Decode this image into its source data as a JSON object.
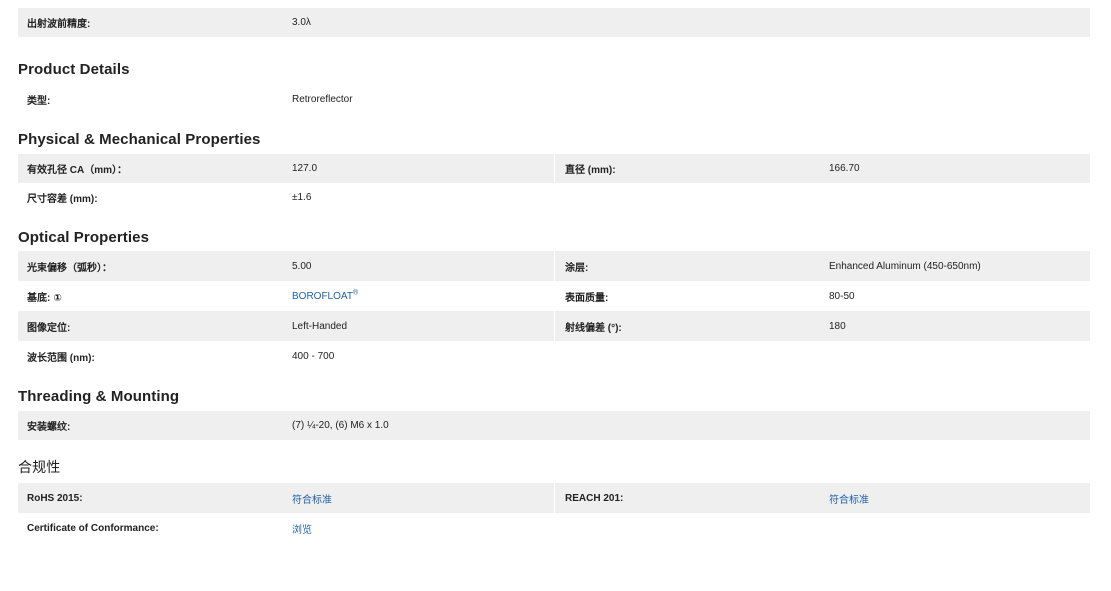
{
  "top_row": {
    "label": "出射波前精度:",
    "value": "3.0λ"
  },
  "sections": {
    "product_details": {
      "title": "Product Details",
      "type_label": "类型:",
      "type_value": "Retroreflector"
    },
    "physical": {
      "title": "Physical & Mechanical Properties",
      "ca_label": "有效孔径 CA（mm）：",
      "ca_value": "127.0",
      "diameter_label": "直径 (mm):",
      "diameter_value": "166.70",
      "tolerance_label": "尺寸容差 (mm):",
      "tolerance_value": "±1.6"
    },
    "optical": {
      "title": "Optical Properties",
      "deviation_label": "光束偏移（弧秒）：",
      "deviation_value": "5.00",
      "coating_label": "涂层:",
      "coating_value": "Enhanced Aluminum (450-650nm)",
      "substrate_label": "基底:",
      "substrate_info_icon": "①",
      "substrate_value": "BOROFLOAT",
      "substrate_sup": "®",
      "surface_label": "表面质量:",
      "surface_value": "80-50",
      "image_label": "图像定位:",
      "image_value": "Left-Handed",
      "ray_label": "射线偏差 (°):",
      "ray_value": "180",
      "wavelength_label": "波长范围 (nm):",
      "wavelength_value": "400 - 700"
    },
    "threading": {
      "title": "Threading & Mounting",
      "thread_label": "安装螺纹:",
      "thread_value": "(7) ¼-20, (6) M6 x 1.0"
    },
    "compliance": {
      "title": "合规性",
      "rohs_label": "RoHS 2015:",
      "rohs_value": "符合标准",
      "reach_label": "REACH 201:",
      "reach_value": "符合标准",
      "coc_label": "Certificate of Conformance:",
      "coc_value": "浏览"
    }
  },
  "colors": {
    "shaded_row": "#efefef",
    "link": "#1f5fa6",
    "text": "#222222"
  }
}
